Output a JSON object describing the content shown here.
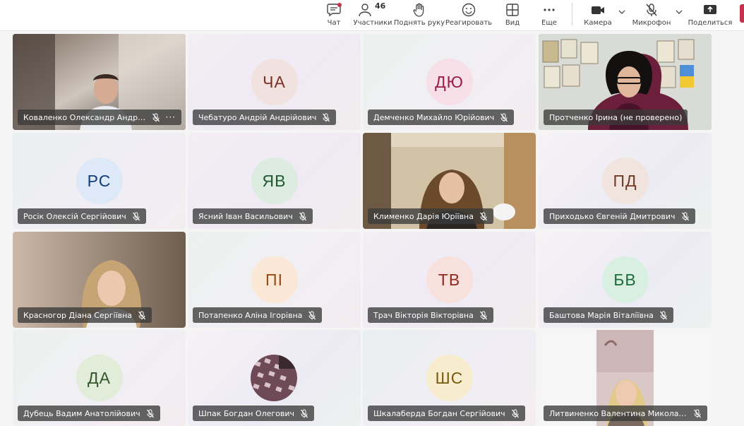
{
  "toolbar": {
    "chat": "Чат",
    "participants": "Участники",
    "participants_count": "46",
    "raise_hand": "Поднять руку",
    "react": "Реагировать",
    "view": "Вид",
    "more": "Еще",
    "camera": "Камера",
    "microphone": "Микрофон",
    "share": "Поделиться"
  },
  "tiles": [
    {
      "name": "Коваленко Олександр Андрій...",
      "type": "video",
      "more": "···"
    },
    {
      "name": "Чебатуро Андрій Андрійович",
      "initials": "ЧА"
    },
    {
      "name": "Демченко Михайло Юрійович",
      "initials": "ДЮ"
    },
    {
      "name": "Протченко Ірина (не проверено)",
      "type": "video"
    },
    {
      "name": "Росік Олексій Сергійович",
      "initials": "РС"
    },
    {
      "name": "Ясний Іван Васильович",
      "initials": "ЯВ"
    },
    {
      "name": "Клименко Дарія Юріївна",
      "type": "video"
    },
    {
      "name": "Приходько Євгеній Дмитрович",
      "initials": "ПД"
    },
    {
      "name": "Красногор Діана Сергіївна",
      "type": "video"
    },
    {
      "name": "Потапенко Аліна Ігорівна",
      "initials": "ПІ"
    },
    {
      "name": "Трач Вікторія Вікторівна",
      "initials": "ТВ"
    },
    {
      "name": "Баштова Марія Віталіївна",
      "initials": "БВ"
    },
    {
      "name": "Дубець Вадим Анатолійович",
      "initials": "ДА"
    },
    {
      "name": "Шпак Богдан Олегович",
      "type": "photo"
    },
    {
      "name": "Шкалаберда Богдан Сергійович",
      "initials": "ШС"
    },
    {
      "name": "Литвиненко Валентина Миколаївна",
      "type": "video"
    }
  ],
  "colors": {
    "ЧА": [
      "#f1e2df",
      "#7a2f26"
    ],
    "ДЮ": [
      "#f6dfe6",
      "#9a1e4b"
    ],
    "РС": [
      "#dde9f6",
      "#123b7a"
    ],
    "ЯВ": [
      "#dcece0",
      "#1f5a32"
    ],
    "ПД": [
      "#f1e4df",
      "#6f3a26"
    ],
    "ПІ": [
      "#fbe7d6",
      "#9a4b12"
    ],
    "ТВ": [
      "#f8e0dc",
      "#8f2a1e"
    ],
    "БВ": [
      "#d9efe1",
      "#1d6b3a"
    ],
    "ДА": [
      "#e1ecd9",
      "#33562a"
    ],
    "ШС": [
      "#f8ecce",
      "#7a5a10"
    ]
  }
}
